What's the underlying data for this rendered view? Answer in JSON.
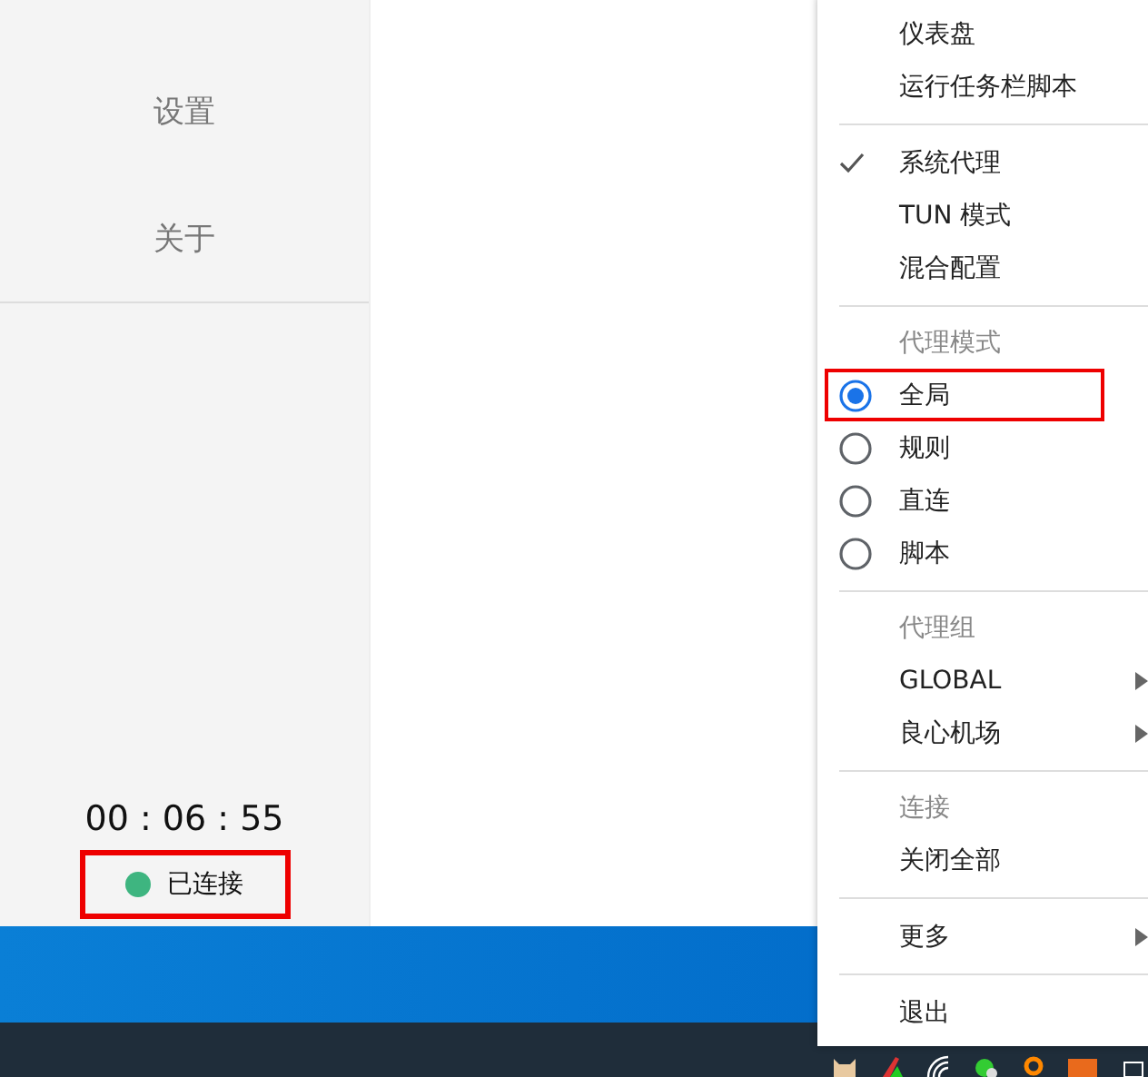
{
  "sidebar": {
    "items": [
      {
        "label": "设置",
        "selected": false
      },
      {
        "label": "关于",
        "selected": false
      }
    ],
    "timer": "00 : 06 : 55",
    "status": {
      "label": "已连接",
      "color": "#3eb580",
      "highlighted": true
    }
  },
  "menu": {
    "sections": [
      {
        "items": [
          {
            "kind": "plain",
            "label": "仪表盘"
          },
          {
            "kind": "plain",
            "label": "运行任务栏脚本"
          }
        ]
      },
      {
        "items": [
          {
            "kind": "check",
            "label": "系统代理",
            "checked": true
          },
          {
            "kind": "check",
            "label": "TUN 模式",
            "checked": false
          },
          {
            "kind": "check",
            "label": "混合配置",
            "checked": false
          }
        ]
      },
      {
        "header": "代理模式",
        "items": [
          {
            "kind": "radio",
            "label": "全局",
            "selected": true,
            "highlighted": true
          },
          {
            "kind": "radio",
            "label": "规则",
            "selected": false,
            "highlighted": false
          },
          {
            "kind": "radio",
            "label": "直连",
            "selected": false,
            "highlighted": false
          },
          {
            "kind": "radio",
            "label": "脚本",
            "selected": false,
            "highlighted": false
          }
        ]
      },
      {
        "header": "代理组",
        "items": [
          {
            "kind": "submenu",
            "label": "GLOBAL"
          },
          {
            "kind": "submenu",
            "label": "良心机场"
          }
        ]
      },
      {
        "header": "连接",
        "items": [
          {
            "kind": "plain",
            "label": "关闭全部"
          }
        ]
      },
      {
        "items": [
          {
            "kind": "submenu",
            "label": "更多"
          }
        ]
      },
      {
        "items": [
          {
            "kind": "plain",
            "label": "退出"
          }
        ]
      }
    ]
  }
}
